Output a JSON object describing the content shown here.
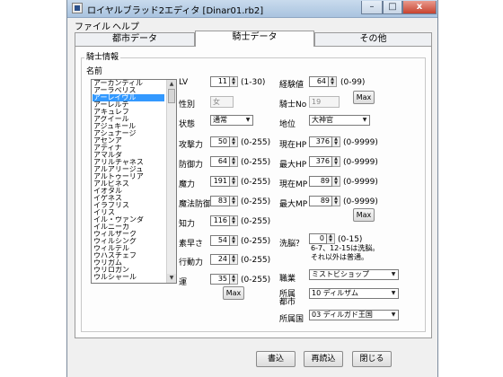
{
  "window": {
    "title": "ロイヤルブラッド2エディタ [Dinar01.rb2]"
  },
  "caption_buttons": {
    "minimize": "–",
    "maximize": "□",
    "close": "x"
  },
  "menu": [
    "ファイル",
    "ヘルプ"
  ],
  "tabs": [
    {
      "label": "都市データ",
      "active": false
    },
    {
      "label": "騎士データ",
      "active": true
    },
    {
      "label": "その他",
      "active": false
    }
  ],
  "group": {
    "title": "騎士情報",
    "name_label": "名前"
  },
  "names": {
    "items": [
      "アーカンディル",
      "アーラベリス",
      "アーレイヴル",
      "アーレルテ",
      "アキュレフ",
      "アグイール",
      "アジュキール",
      "アシュナージ",
      "アセンア",
      "アディナ",
      "アマルダ",
      "アリルチャネス",
      "アルアリージュ",
      "アルトゥーリア",
      "アルビネス",
      "イオタル",
      "イゲネス",
      "イラブリス",
      "イリス",
      "イル・ヴァンダ",
      "イルニーカ",
      "ウィルザーク",
      "ウィルシング",
      "ウィルデル",
      "ウハスチェフ",
      "ウリガム",
      "ウリロガン",
      "ウルシャール"
    ],
    "selected_index": 2
  },
  "fields_left": [
    {
      "label": "LV",
      "value": "11",
      "range": "(1-30)"
    },
    {
      "label": "攻撃力",
      "value": "50",
      "range": "(0-255)"
    },
    {
      "label": "防御力",
      "value": "64",
      "range": "(0-255)"
    },
    {
      "label": "魔力",
      "value": "191",
      "range": "(0-255)"
    },
    {
      "label": "魔法防御",
      "value": "83",
      "range": "(0-255)"
    },
    {
      "label": "知力",
      "value": "116",
      "range": "(0-255)"
    },
    {
      "label": "素早さ",
      "value": "54",
      "range": "(0-255)"
    },
    {
      "label": "行動力",
      "value": "24",
      "range": "(0-255)"
    },
    {
      "label": "運",
      "value": "35",
      "range": "(0-255)"
    }
  ],
  "sex": {
    "label": "性別",
    "value": "女"
  },
  "state": {
    "label": "状態",
    "value": "通常"
  },
  "exp": {
    "label": "経験値",
    "value": "64",
    "range": "(0-99)"
  },
  "knight_no": {
    "label": "騎士No",
    "value": "19"
  },
  "rank": {
    "label": "地位",
    "value": "大神官"
  },
  "fields_right": [
    {
      "label": "現在HP",
      "value": "376",
      "range": "(0-9999)"
    },
    {
      "label": "最大HP",
      "value": "376",
      "range": "(0-9999)"
    },
    {
      "label": "現在MP",
      "value": "89",
      "range": "(0-9999)"
    },
    {
      "label": "最大MP",
      "value": "89",
      "range": "(0-9999)"
    }
  ],
  "brainwash": {
    "label": "洗脳？",
    "value": "0",
    "range": "(0-15)",
    "note1": "6-7、12-15は洗脳。",
    "note2": "それ以外は普通。"
  },
  "job": {
    "label": "職業",
    "value": "ミストビショップ"
  },
  "city": {
    "label1": "所属",
    "label2": "都市",
    "value": "10 ディルザム"
  },
  "country": {
    "label": "所属国",
    "value": "03 ディルガド王国"
  },
  "max_label": "Max",
  "buttons": {
    "write": "書込",
    "reload": "再読込",
    "close": "閉じる"
  }
}
